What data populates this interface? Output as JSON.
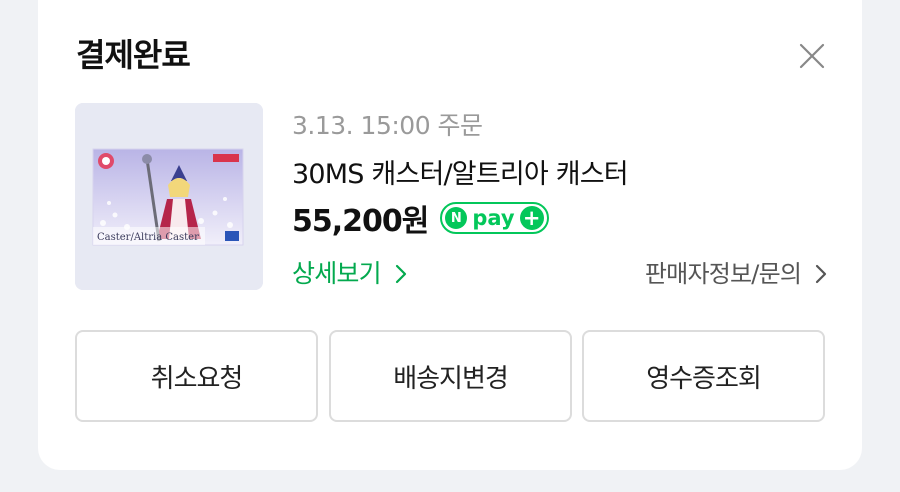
{
  "header": {
    "title": "결제완료",
    "close_icon": "close-icon"
  },
  "order": {
    "date": "3.13. 15:00 주문",
    "product_name": "30MS 캐스터/알트리아 캐스터",
    "thumbnail_caption": "Caster/Altria Caster",
    "price": "55,200원",
    "payment_badge": {
      "n_mark": "N",
      "text": "pay",
      "plus": "+"
    },
    "detail_link": "상세보기",
    "seller_link": "판매자정보/문의"
  },
  "actions": {
    "cancel_label": "취소요청",
    "change_address_label": "배송지변경",
    "receipt_label": "영수증조회"
  },
  "colors": {
    "accent_green": "#03c75a",
    "link_green": "#03a94e"
  }
}
